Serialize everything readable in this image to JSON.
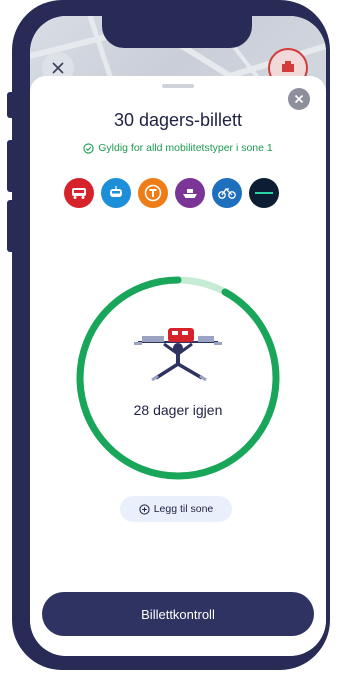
{
  "ticket": {
    "title": "30 dagers-billett",
    "validity": "Gyldig for alld mobilitetstyper i sone 1",
    "remaining": "28 dager igjen",
    "remaining_fraction": 0.92
  },
  "modes": [
    {
      "icon": "bus-icon",
      "color": "#d6232b"
    },
    {
      "icon": "tram-icon",
      "color": "#1c8fd8"
    },
    {
      "icon": "metro-icon",
      "color": "#ee7d18"
    },
    {
      "icon": "boat-icon",
      "color": "#7a3596"
    },
    {
      "icon": "bike-icon",
      "color": "#1f6fbf"
    },
    {
      "icon": "scooter-brand-icon",
      "color": "#0d1d33"
    }
  ],
  "actions": {
    "add_zone": "Legg til sone",
    "ticket_control": "Billettkontroll"
  },
  "colors": {
    "progress": "#1aa65a",
    "progress_track": "#c7ecd5",
    "primary": "#2f3361"
  }
}
